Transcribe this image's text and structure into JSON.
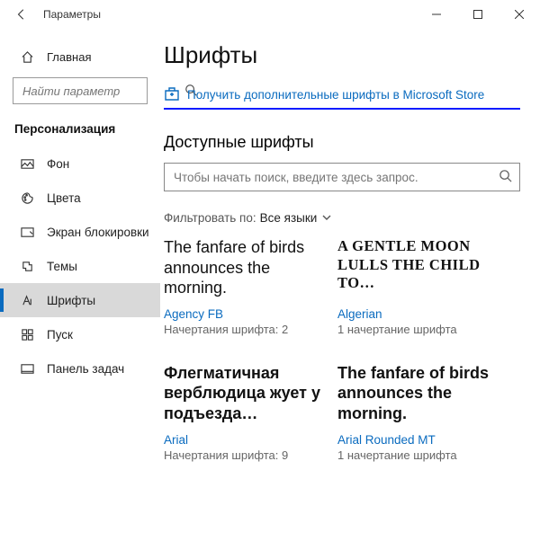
{
  "window": {
    "title": "Параметры"
  },
  "sidebar": {
    "home": "Главная",
    "search_placeholder": "Найти параметр",
    "category": "Персонализация",
    "items": [
      {
        "label": "Фон"
      },
      {
        "label": "Цвета"
      },
      {
        "label": "Экран блокировки"
      },
      {
        "label": "Темы"
      },
      {
        "label": "Шрифты"
      },
      {
        "label": "Пуск"
      },
      {
        "label": "Панель задач"
      }
    ]
  },
  "main": {
    "page_title": "Шрифты",
    "store_link": "Получить дополнительные шрифты в Microsoft Store",
    "available_title": "Доступные шрифты",
    "search_placeholder": "Чтобы начать поиск, введите здесь запрос.",
    "filter_label": "Фильтровать по:",
    "filter_value": "Все языки",
    "fonts": [
      {
        "sample": "The fanfare of birds announces the morning.",
        "name": "Agency FB",
        "meta": "Начертания шрифта: 2"
      },
      {
        "sample": "A gentle moon lulls the child to…",
        "name": "Algerian",
        "meta": "1 начертание шрифта"
      },
      {
        "sample": "Флегматичная верблюдица жует у подъезда…",
        "name": "Arial",
        "meta": "Начертания шрифта: 9"
      },
      {
        "sample": "The fanfare of birds announces the morning.",
        "name": "Arial Rounded MT",
        "meta": "1 начертание шрифта"
      }
    ]
  }
}
